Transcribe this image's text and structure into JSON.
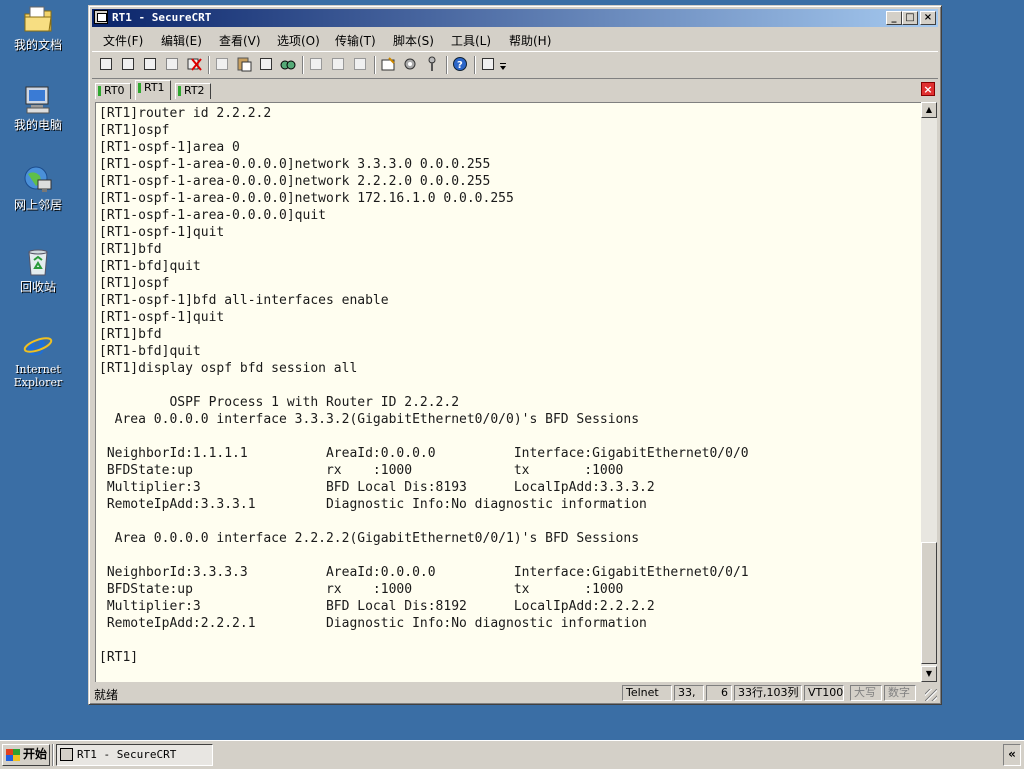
{
  "desktop": {
    "icons": [
      {
        "label": "我的文档",
        "icon": "folder-documents-icon"
      },
      {
        "label": "我的电脑",
        "icon": "computer-icon"
      },
      {
        "label": "网上邻居",
        "icon": "network-icon"
      },
      {
        "label": "回收站",
        "icon": "recycle-bin-icon"
      },
      {
        "label": "Internet Explorer",
        "icon": "internet-explorer-icon"
      }
    ]
  },
  "window": {
    "title": "RT1 - SecureCRT",
    "controls": {
      "minimize": "_",
      "maximize": "□",
      "close": "×"
    }
  },
  "menu": [
    "文件(F)",
    "编辑(E)",
    "查看(V)",
    "选项(O)",
    "传输(T)",
    "脚本(S)",
    "工具(L)",
    "帮助(H)"
  ],
  "tabs": [
    {
      "label": "RT0",
      "active": false
    },
    {
      "label": "RT1",
      "active": true
    },
    {
      "label": "RT2",
      "active": false
    }
  ],
  "tab_close": "×",
  "terminal": {
    "lines": [
      "[RT1]router id 2.2.2.2",
      "[RT1]ospf",
      "[RT1-ospf-1]area 0",
      "[RT1-ospf-1-area-0.0.0.0]network 3.3.3.0 0.0.0.255",
      "[RT1-ospf-1-area-0.0.0.0]network 2.2.2.0 0.0.0.255",
      "[RT1-ospf-1-area-0.0.0.0]network 172.16.1.0 0.0.0.255",
      "[RT1-ospf-1-area-0.0.0.0]quit",
      "[RT1-ospf-1]quit",
      "[RT1]bfd",
      "[RT1-bfd]quit",
      "[RT1]ospf",
      "[RT1-ospf-1]bfd all-interfaces enable",
      "[RT1-ospf-1]quit",
      "[RT1]bfd",
      "[RT1-bfd]quit",
      "[RT1]display ospf bfd session all",
      "",
      "         OSPF Process 1 with Router ID 2.2.2.2",
      "  Area 0.0.0.0 interface 3.3.3.2(GigabitEthernet0/0/0)'s BFD Sessions",
      "",
      " NeighborId:1.1.1.1          AreaId:0.0.0.0          Interface:GigabitEthernet0/0/0",
      " BFDState:up                 rx    :1000             tx       :1000",
      " Multiplier:3                BFD Local Dis:8193      LocalIpAdd:3.3.3.2",
      " RemoteIpAdd:3.3.3.1         Diagnostic Info:No diagnostic information",
      "",
      "  Area 0.0.0.0 interface 2.2.2.2(GigabitEthernet0/0/1)'s BFD Sessions",
      "",
      " NeighborId:3.3.3.3          AreaId:0.0.0.0          Interface:GigabitEthernet0/0/1",
      " BFDState:up                 rx    :1000             tx       :1000",
      " Multiplier:3                BFD Local Dis:8192      LocalIpAdd:2.2.2.2",
      " RemoteIpAdd:2.2.2.1         Diagnostic Info:No diagnostic information",
      "",
      "[RT1]"
    ]
  },
  "status": {
    "ready": "就绪",
    "protocol": "Telnet",
    "row": "33,",
    "col": "6",
    "rowcol": "33行,103列",
    "emulation": "VT100",
    "caps": "大写",
    "num": "数字"
  },
  "taskbar": {
    "start": "开始",
    "task": "RT1 - SecureCRT",
    "tray_chevron": "«"
  }
}
